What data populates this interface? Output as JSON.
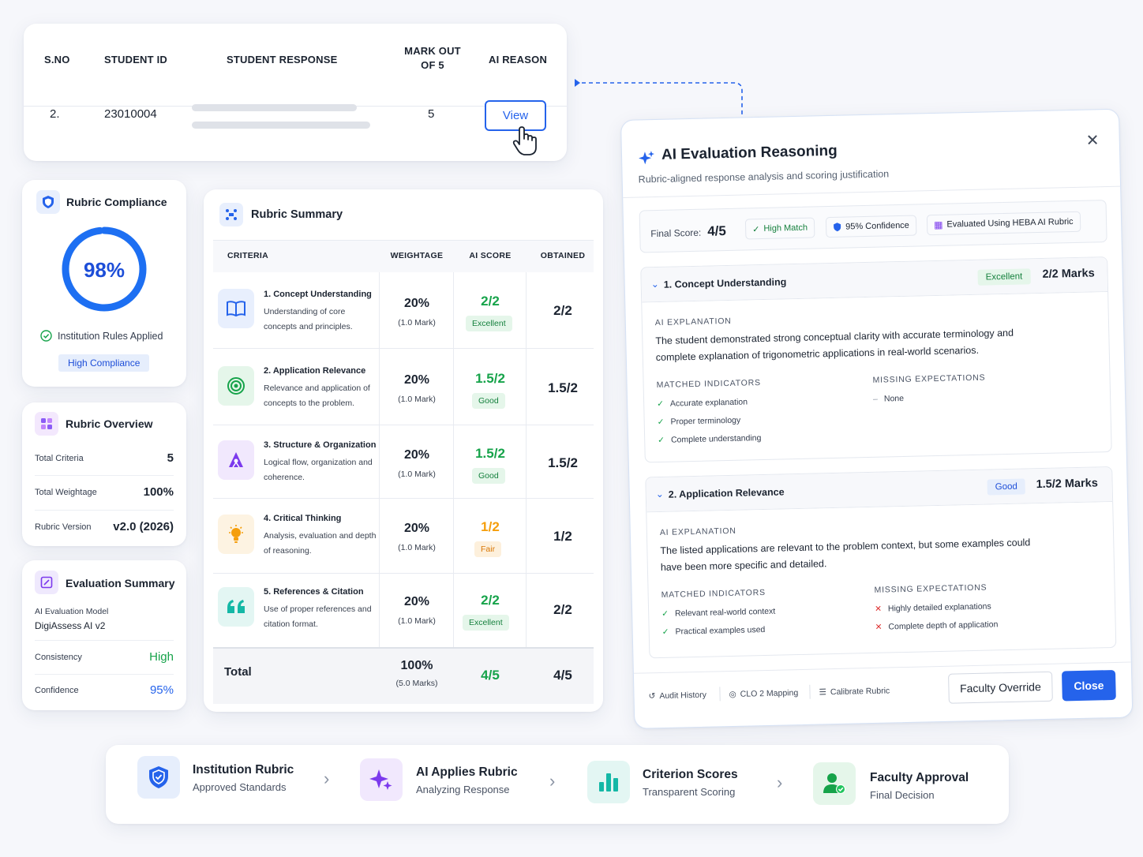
{
  "student_table": {
    "headers": [
      "S.NO",
      "STUDENT ID",
      "STUDENT RESPONSE",
      "MARK OUT OF 5",
      "AI REASON"
    ],
    "row": {
      "sno": "2.",
      "student_id": "23010004",
      "mark": "5",
      "reason_button": "View"
    }
  },
  "compliance": {
    "title": "Rubric Compliance",
    "percent_label": "98%",
    "percent_value": 0.98,
    "rules_text": "Institution Rules Applied",
    "badge": "High Compliance"
  },
  "overview": {
    "title": "Rubric Overview",
    "rows": [
      {
        "label": "Total Criteria",
        "value": "5"
      },
      {
        "label": "Total Weightage",
        "value": "100%"
      },
      {
        "label": "Rubric Version",
        "value": "v2.0 (2026)"
      }
    ]
  },
  "eval_summary": {
    "title": "Evaluation Summary",
    "model_label": "AI Evaluation Model",
    "model_value": "DigiAssess AI v2",
    "rows": [
      {
        "label": "Consistency",
        "value": "High",
        "color": "#16a34a"
      },
      {
        "label": "Confidence",
        "value": "95%",
        "color": "#2563eb"
      }
    ]
  },
  "rubric_summary": {
    "title": "Rubric Summary",
    "columns": [
      "CRITERIA",
      "WEIGHTAGE",
      "AI SCORE",
      "OBTAINED"
    ],
    "rows": [
      {
        "title": "1. Concept Understanding",
        "desc": "Understanding of core concepts and principles.",
        "weight": "20%",
        "weight_sub": "(1.0 Mark)",
        "score": "2/2",
        "badge": "Excellent",
        "obtained": "2/2",
        "icon": "book-icon",
        "tone": "green"
      },
      {
        "title": "2. Application Relevance",
        "desc": "Relevance and application of concepts to the problem.",
        "weight": "20%",
        "weight_sub": "(1.0 Mark)",
        "score": "1.5/2",
        "badge": "Good",
        "obtained": "1.5/2",
        "icon": "target-icon",
        "tone": "green"
      },
      {
        "title": "3. Structure & Organization",
        "desc": "Logical flow, organization and coherence.",
        "weight": "20%",
        "weight_sub": "(1.0 Mark)",
        "score": "1.5/2",
        "badge": "Good",
        "obtained": "1.5/2",
        "icon": "hierarchy-icon",
        "tone": "green"
      },
      {
        "title": "4. Critical Thinking",
        "desc": "Analysis, evaluation and depth of reasoning.",
        "weight": "20%",
        "weight_sub": "(1.0 Mark)",
        "score": "1/2",
        "badge": "Fair",
        "obtained": "1/2",
        "icon": "lightbulb-icon",
        "tone": "orange"
      },
      {
        "title": "5. References & Citation",
        "desc": "Use of proper references and citation format.",
        "weight": "20%",
        "weight_sub": "(1.0 Mark)",
        "score": "2/2",
        "badge": "Excellent",
        "obtained": "2/2",
        "icon": "quote-icon",
        "tone": "green"
      }
    ],
    "total": {
      "label": "Total",
      "weight": "100%",
      "weight_sub": "(5.0 Marks)",
      "score": "4/5",
      "obtained": "4/5"
    }
  },
  "modal": {
    "title": "AI Evaluation Reasoning",
    "subtitle": "Rubric-aligned response analysis and scoring justification",
    "final_score_label": "Final Score:",
    "final_score": "4/5",
    "match_pill": "High Match",
    "confidence_pill": "95% Confidence",
    "rubric_pill": "Evaluated Using HEBA AI Rubric",
    "criteria": [
      {
        "title": "1. Concept Understanding",
        "badge": "Excellent",
        "marks": "2/2 Marks",
        "explanation_label": "AI EXPLANATION",
        "explanation": "The student demonstrated strong conceptual clarity with accurate terminology and complete explanation of trigonometric applications in real-world scenarios.",
        "matched_label": "MATCHED INDICATORS",
        "matched": [
          "Accurate explanation",
          "Proper terminology",
          "Complete understanding"
        ],
        "missing_label": "MISSING EXPECTATIONS",
        "missing": [
          "None"
        ]
      },
      {
        "title": "2. Application Relevance",
        "badge": "Good",
        "marks": "1.5/2 Marks",
        "explanation_label": "AI EXPLANATION",
        "explanation": "The listed applications are relevant to the problem context, but some examples could have been more specific and detailed.",
        "matched_label": "MATCHED INDICATORS",
        "matched": [
          "Relevant real-world context",
          "Practical examples used"
        ],
        "missing_label": "MISSING EXPECTATIONS",
        "missing": [
          "Highly detailed explanations",
          "Complete depth of application"
        ]
      }
    ],
    "footer": {
      "audit": "Audit History",
      "clo": "CLO 2 Mapping",
      "calibrate": "Calibrate Rubric",
      "override_button": "Faculty Override",
      "close_button": "Close"
    }
  },
  "process": [
    {
      "title": "Institution Rubric",
      "sub": "Approved Standards",
      "icon": "shield-icon"
    },
    {
      "title": "AI Applies Rubric",
      "sub": "Analyzing Response",
      "icon": "sparkle-icon"
    },
    {
      "title": "Criterion Scores",
      "sub": "Transparent Scoring",
      "icon": "bar-chart-icon"
    },
    {
      "title": "Faculty Approval",
      "sub": "Final Decision",
      "icon": "user-check-icon"
    }
  ],
  "colors": {
    "accent": "#2563eb",
    "green": "#16a34a",
    "orange": "#f59e0b",
    "purple": "#7c3aed"
  }
}
